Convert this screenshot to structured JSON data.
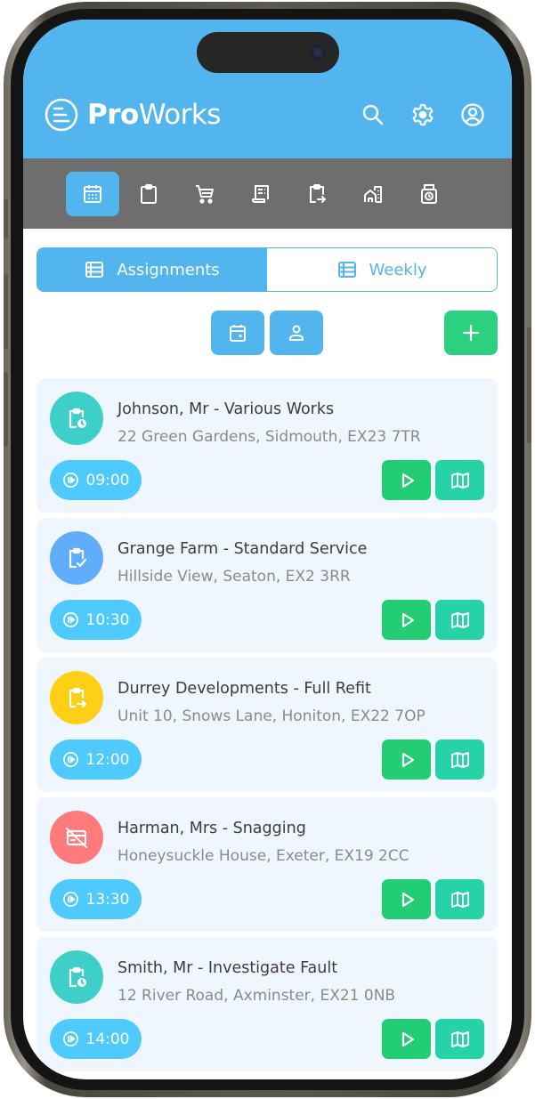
{
  "app": {
    "brand_bold": "Pro",
    "brand_regular": "Works",
    "header_icons": [
      "search-icon",
      "gear-icon",
      "user-circle-icon"
    ]
  },
  "colors": {
    "primary": "#53b5ee",
    "toolbar": "#6e6e6e",
    "success": "#2bd17e",
    "card_bg": "#eff6fd",
    "time_pill": "#4fcaff",
    "play_button": "#22cd74",
    "map_button": "#25d3a6"
  },
  "toolbar": {
    "items": [
      {
        "icon": "calendar-icon",
        "active": true
      },
      {
        "icon": "clipboard-icon",
        "active": false
      },
      {
        "icon": "cart-icon",
        "active": false
      },
      {
        "icon": "receipt-icon",
        "active": false
      },
      {
        "icon": "clipboard-export-icon",
        "active": false
      },
      {
        "icon": "buildings-icon",
        "active": false
      },
      {
        "icon": "time-clock-icon",
        "active": false
      }
    ]
  },
  "tabs": [
    {
      "label": "Assignments",
      "icon": "list-icon",
      "active": true
    },
    {
      "label": "Weekly",
      "icon": "list-icon",
      "active": false
    }
  ],
  "actions": {
    "date_filter_icon": "calendar-day-icon",
    "user_filter_icon": "user-icon",
    "add_icon": "plus-icon"
  },
  "assignments": [
    {
      "title": "Johnson, Mr - Various Works",
      "address": "22 Green Gardens, Sidmouth, EX23 7TR",
      "time": "09:00",
      "status_icon": "clipboard-clock-icon",
      "status_color": "#3ecfc8"
    },
    {
      "title": "Grange Farm - Standard Service",
      "address": "Hillside View, Seaton, EX2 3RR",
      "time": "10:30",
      "status_icon": "clipboard-check-icon",
      "status_color": "#5fadfb"
    },
    {
      "title": "Durrey Developments - Full Refit",
      "address": "Unit 10, Snows Lane, Honiton, EX22 7OP",
      "time": "12:00",
      "status_icon": "clipboard-export-icon",
      "status_color": "#fdd017"
    },
    {
      "title": "Harman, Mrs - Snagging",
      "address": "Honeysuckle House, Exeter, EX19 2CC",
      "time": "13:30",
      "status_icon": "card-off-icon",
      "status_color": "#ff7a7a"
    },
    {
      "title": "Smith, Mr - Investigate Fault",
      "address": "12 River Road, Axminster, EX21 0NB",
      "time": "14:00",
      "status_icon": "clipboard-clock-icon",
      "status_color": "#3ecfc8"
    }
  ]
}
